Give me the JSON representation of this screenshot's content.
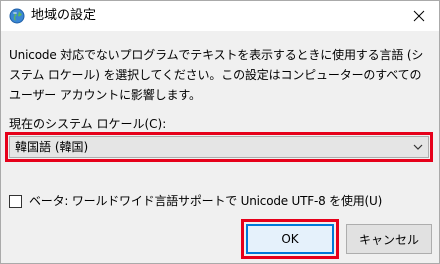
{
  "window": {
    "title": "地域の設定",
    "icon": "globe-icon",
    "close_icon": "close-icon"
  },
  "description": "Unicode 対応でないプログラムでテキストを表示するときに使用する言語 (システム ロケール) を選択してください。この設定はコンピューターのすべてのユーザー アカウントに影響します。",
  "locale": {
    "label": "現在のシステム ロケール(C):",
    "selected_value": "韓国語 (韓国)"
  },
  "beta_option": {
    "label": "ベータ: ワールドワイド言語サポートで Unicode UTF-8 を使用(U)",
    "checked": false
  },
  "buttons": {
    "ok_label": "OK",
    "cancel_label": "キャンセル"
  },
  "colors": {
    "highlight": "#e6001a",
    "accent": "#0078d7"
  }
}
